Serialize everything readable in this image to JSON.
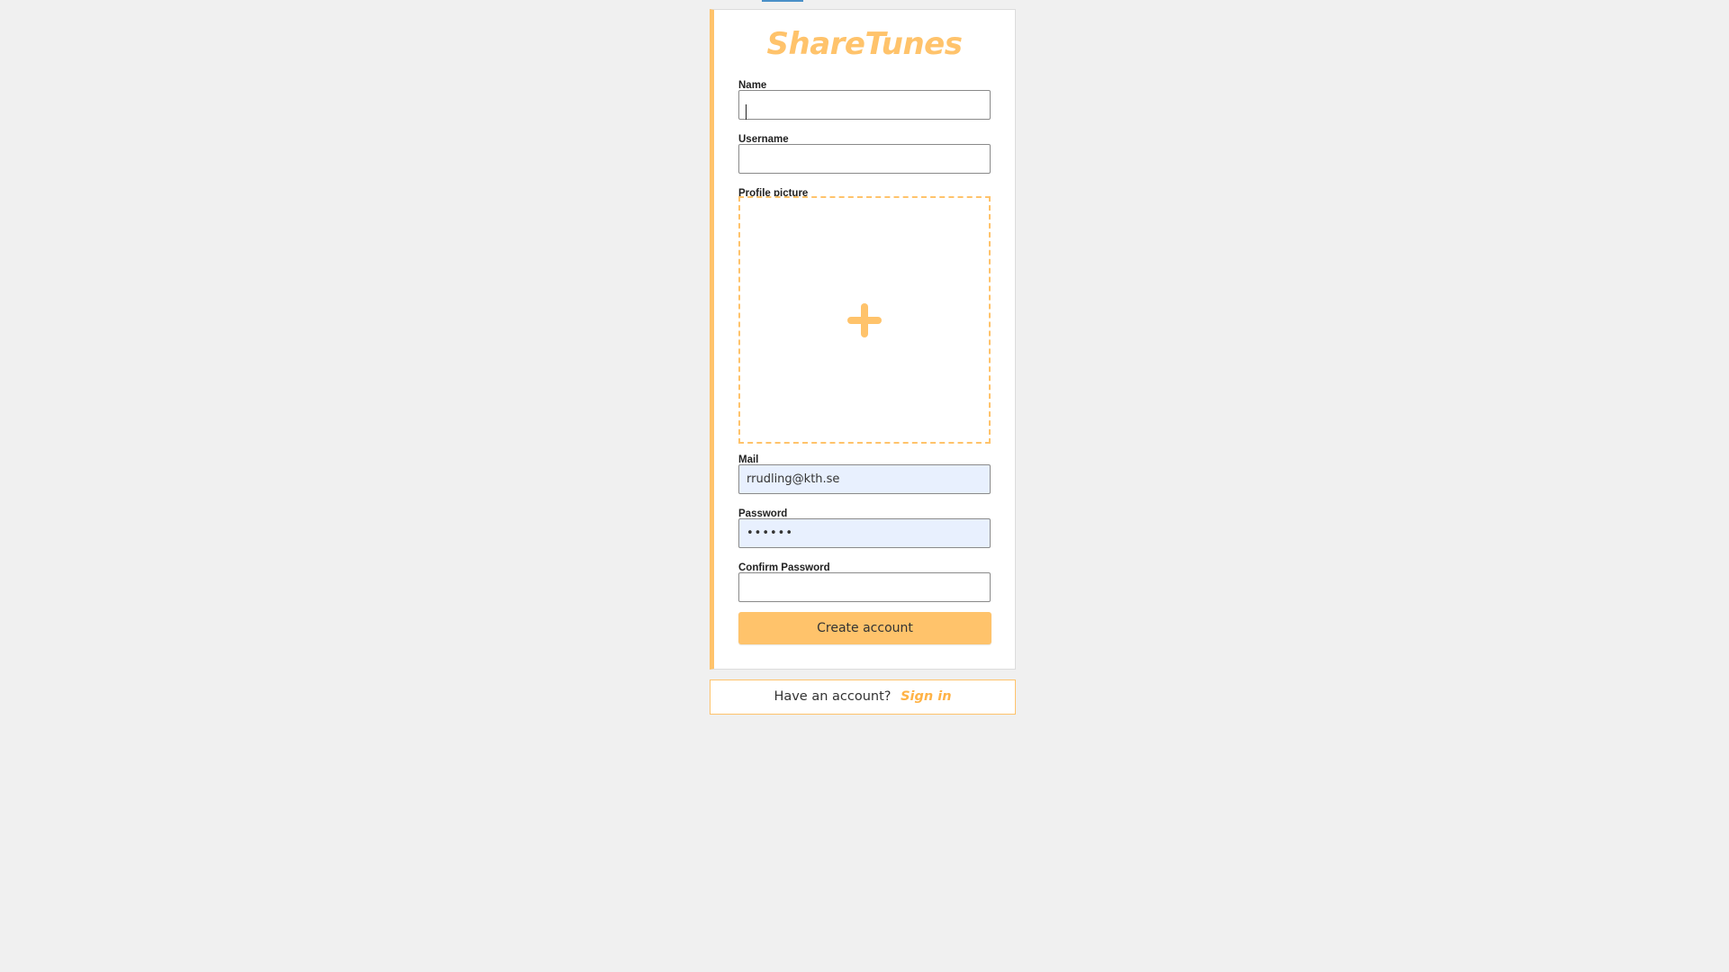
{
  "app": {
    "logo_text": "ShareTunes",
    "accent_color": "#ffc36b"
  },
  "form": {
    "name": {
      "label": "Name",
      "value": ""
    },
    "username": {
      "label": "Username",
      "value": ""
    },
    "profile_picture": {
      "label": "Profile picture",
      "icon": "plus-icon"
    },
    "mail": {
      "label": "Mail",
      "value": "rrudling@kth.se"
    },
    "password": {
      "label": "Password",
      "value": "••••••"
    },
    "confirm_password": {
      "label": "Confirm Password",
      "value": ""
    },
    "submit_label": "Create account"
  },
  "signin": {
    "prompt": "Have an account?",
    "link_label": "Sign in"
  }
}
